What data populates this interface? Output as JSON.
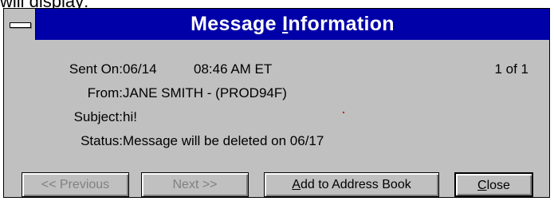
{
  "page_top_text": "will display:",
  "window": {
    "title_prefix": "Message ",
    "title_underlined": "I",
    "title_suffix": "nformation"
  },
  "message": {
    "sent_on_label": "Sent On:",
    "sent_date": "06/14",
    "sent_time": "08:46 AM ET",
    "counter": "1 of 1",
    "from_label": "From:",
    "from_value": "JANE SMITH - (PROD94F)",
    "subject_label": "Subject:",
    "subject_value": "hi!",
    "status_label": "Status:",
    "status_value": "Message will be deleted on 06/17"
  },
  "buttons": {
    "previous": "<< Previous",
    "next": "Next >>",
    "add_underlined": "A",
    "add_rest": "dd to Address Book",
    "close_underlined": "C",
    "close_rest": "lose"
  },
  "colors": {
    "titlebar": "#0000a8",
    "dialog_face": "#c0c0c0",
    "disabled_text": "#808080"
  }
}
